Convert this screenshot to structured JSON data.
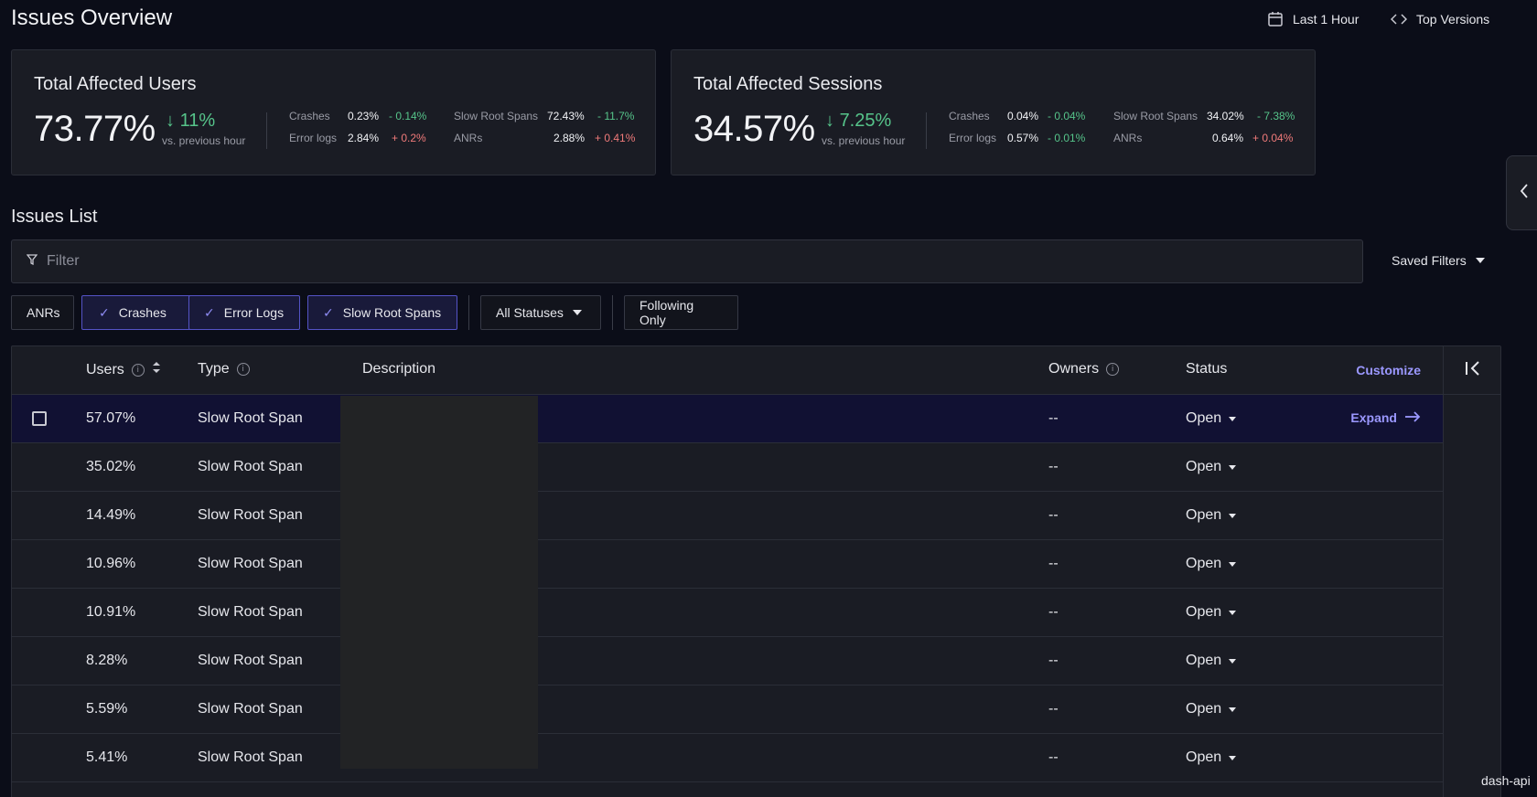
{
  "header": {
    "title": "Issues Overview",
    "time_range": "Last 1 Hour",
    "versions": "Top Versions"
  },
  "cards": [
    {
      "title": "Total Affected Users",
      "value": "73.77%",
      "delta": "11%",
      "delta_direction": "down",
      "compare": "vs. previous hour",
      "metrics": {
        "crashes": {
          "label": "Crashes",
          "value": "0.23%",
          "change": "- 0.14%"
        },
        "error_logs": {
          "label": "Error logs",
          "value": "2.84%",
          "change": "+ 0.2%"
        },
        "slow_root_spans": {
          "label": "Slow Root Spans",
          "value": "72.43%",
          "change": "- 11.7%"
        },
        "anrs": {
          "label": "ANRs",
          "value": "2.88%",
          "change": "+ 0.41%"
        }
      }
    },
    {
      "title": "Total Affected Sessions",
      "value": "34.57%",
      "delta": "7.25%",
      "delta_direction": "down",
      "compare": "vs. previous hour",
      "metrics": {
        "crashes": {
          "label": "Crashes",
          "value": "0.04%",
          "change": "- 0.04%"
        },
        "error_logs": {
          "label": "Error logs",
          "value": "0.57%",
          "change": "- 0.01%"
        },
        "slow_root_spans": {
          "label": "Slow Root Spans",
          "value": "34.02%",
          "change": "- 7.38%"
        },
        "anrs": {
          "label": "ANRs",
          "value": "0.64%",
          "change": "+ 0.04%"
        }
      }
    }
  ],
  "issues": {
    "title": "Issues List",
    "filter_placeholder": "Filter",
    "saved_filters": "Saved Filters",
    "chips": {
      "anrs": "ANRs",
      "crashes": "Crashes",
      "error_logs": "Error Logs",
      "slow_root_spans": "Slow Root Spans",
      "all_statuses": "All Statuses",
      "following_only": "Following Only"
    },
    "columns": {
      "users": "Users",
      "type": "Type",
      "description": "Description",
      "owners": "Owners",
      "status": "Status",
      "customize": "Customize"
    },
    "expand_label": "Expand",
    "rows": [
      {
        "users": "57.07%",
        "type": "Slow Root Span",
        "owners": "--",
        "status": "Open"
      },
      {
        "users": "35.02%",
        "type": "Slow Root Span",
        "owners": "--",
        "status": "Open"
      },
      {
        "users": "14.49%",
        "type": "Slow Root Span",
        "owners": "--",
        "status": "Open"
      },
      {
        "users": "10.96%",
        "type": "Slow Root Span",
        "owners": "--",
        "status": "Open"
      },
      {
        "users": "10.91%",
        "type": "Slow Root Span",
        "owners": "--",
        "status": "Open"
      },
      {
        "users": "8.28%",
        "type": "Slow Root Span",
        "owners": "--",
        "status": "Open"
      },
      {
        "users": "5.59%",
        "type": "Slow Root Span",
        "owners": "--",
        "status": "Open"
      },
      {
        "users": "5.41%",
        "type": "Slow Root Span",
        "owners": "--",
        "status": "Open"
      }
    ]
  },
  "footer": {
    "tag": "dash-api"
  },
  "colors": {
    "accent": "#9b98ff",
    "positive_change": "#56c48a",
    "negative_change": "#f07a7a",
    "background": "#0b0d18",
    "card": "#1a1c24"
  }
}
